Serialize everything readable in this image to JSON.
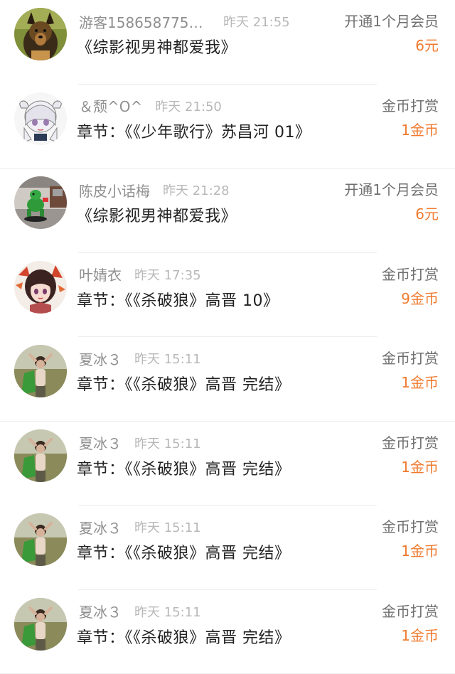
{
  "colors": {
    "accent_orange": "#f07a2e",
    "username_gray": "#8f8f8f",
    "time_gray": "#b8b8b8",
    "title_dark": "#222222",
    "divider": "#ececec"
  },
  "records": [
    {
      "avatar_icon": "german-shepherd-dog-avatar",
      "username": "游客1586587750...",
      "time": "昨天 21:55",
      "title": "《综影视男神都爱我》",
      "type": "开通1个月会员",
      "amount": "6元"
    },
    {
      "avatar_icon": "anime-girl-cow-ears-avatar",
      "username": "＆颓^O^",
      "time": "昨天 21:50",
      "title": "章节：《《少年歌行》苏昌河 01》",
      "type": "金币打赏",
      "amount": "1金币"
    },
    {
      "avatar_icon": "green-toy-figure-avatar",
      "username": "陈皮小话梅",
      "time": "昨天 21:28",
      "title": "《综影视男神都爱我》",
      "type": "开通1个月会员",
      "amount": "6元"
    },
    {
      "avatar_icon": "anime-girl-red-headdress-avatar",
      "username": "叶婧衣",
      "time": "昨天 17:35",
      "title": "章节：《《杀破狼》高晋 10》",
      "type": "金币打赏",
      "amount": "9金币"
    },
    {
      "avatar_icon": "person-in-field-avatar",
      "username": "夏冰３",
      "time": "昨天 15:11",
      "title": "章节：《《杀破狼》高晋 完结》",
      "type": "金币打赏",
      "amount": "1金币"
    },
    {
      "avatar_icon": "person-in-field-avatar",
      "username": "夏冰３",
      "time": "昨天 15:11",
      "title": "章节：《《杀破狼》高晋 完结》",
      "type": "金币打赏",
      "amount": "1金币"
    },
    {
      "avatar_icon": "person-in-field-avatar",
      "username": "夏冰３",
      "time": "昨天 15:11",
      "title": "章节：《《杀破狼》高晋 完结》",
      "type": "金币打赏",
      "amount": "1金币"
    },
    {
      "avatar_icon": "person-in-field-avatar",
      "username": "夏冰３",
      "time": "昨天 15:11",
      "title": "章节：《《杀破狼》高晋 完结》",
      "type": "金币打赏",
      "amount": "1金币"
    }
  ]
}
